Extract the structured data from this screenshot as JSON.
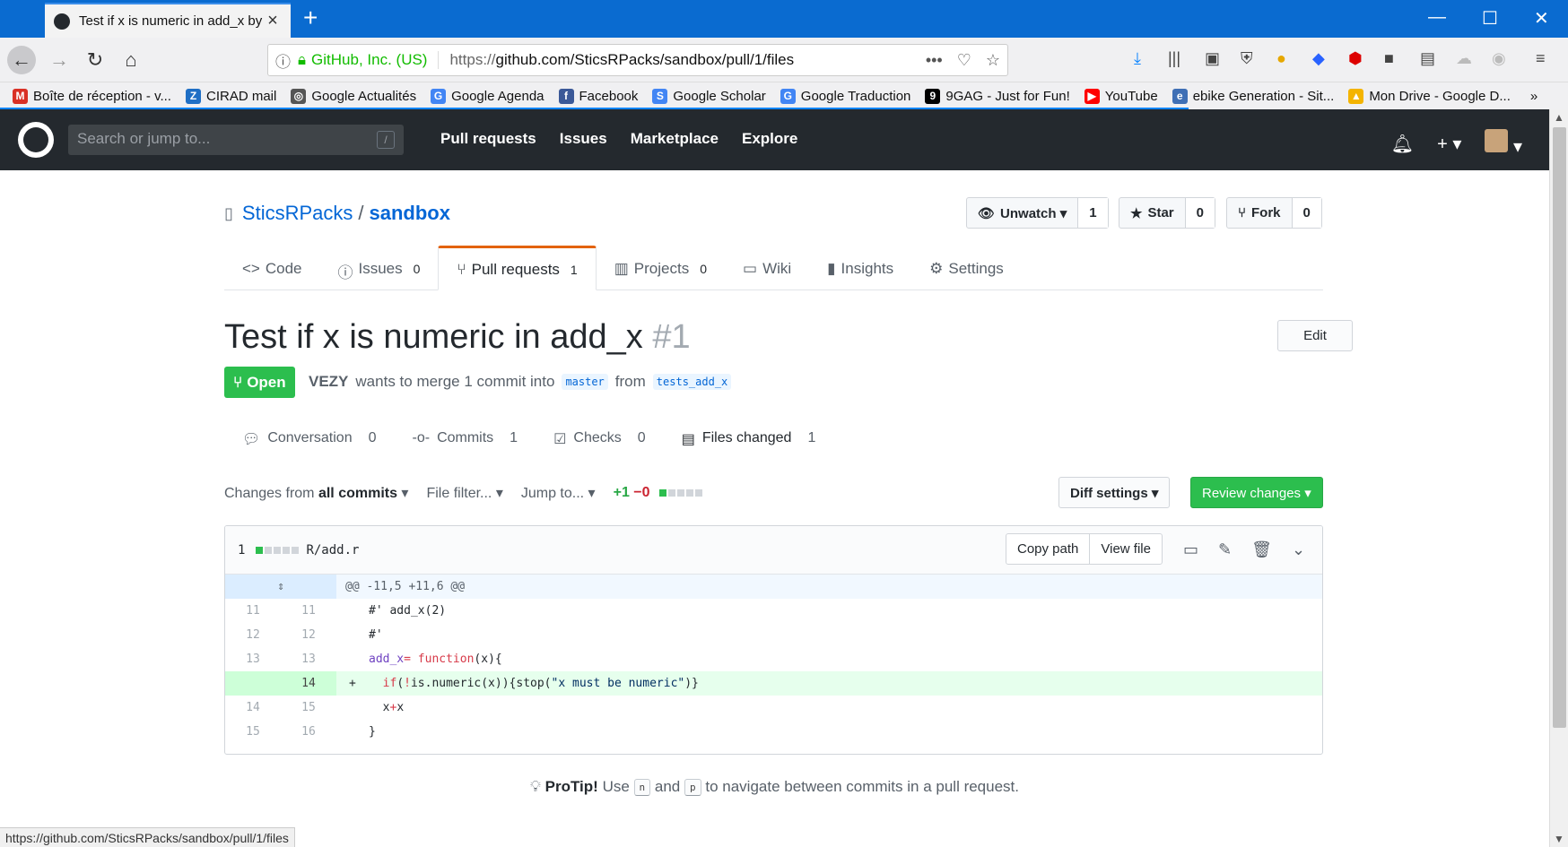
{
  "browser": {
    "tab_title": "Test if x is numeric in add_x by ",
    "url_org": "GitHub, Inc. (US)",
    "url_prefix": "https://",
    "url_host_path": "github.com/SticsRPacks/sandbox/pull/1/files",
    "status_url": "https://github.com/SticsRPacks/sandbox/pull/1/files",
    "bookmarks": [
      {
        "label": "Boîte de réception - v...",
        "icon": "gmail-icon",
        "color": "#d93025",
        "glyph": "M"
      },
      {
        "label": "CIRAD mail",
        "icon": "zimbra-icon",
        "color": "#1f6fc5",
        "glyph": "Z"
      },
      {
        "label": "Google Actualités",
        "icon": "globe-icon",
        "color": "#555555",
        "glyph": "◎"
      },
      {
        "label": "Google Agenda",
        "icon": "google-icon",
        "color": "#4285f4",
        "glyph": "G"
      },
      {
        "label": "Facebook",
        "icon": "facebook-icon",
        "color": "#3b5998",
        "glyph": "f"
      },
      {
        "label": "Google Scholar",
        "icon": "scholar-icon",
        "color": "#4285f4",
        "glyph": "S"
      },
      {
        "label": "Google Traduction",
        "icon": "translate-icon",
        "color": "#4285f4",
        "glyph": "G"
      },
      {
        "label": "9GAG - Just for Fun!",
        "icon": "9gag-icon",
        "color": "#000000",
        "glyph": "9"
      },
      {
        "label": "YouTube",
        "icon": "youtube-icon",
        "color": "#ff0000",
        "glyph": "▶"
      },
      {
        "label": "ebike Generation - Sit...",
        "icon": "ebike-icon",
        "color": "#3f6fb5",
        "glyph": "e"
      },
      {
        "label": "Mon Drive - Google D...",
        "icon": "drive-icon",
        "color": "#f4b400",
        "glyph": "▲"
      }
    ]
  },
  "gh": {
    "search_placeholder": "Search or jump to...",
    "search_key": "/",
    "nav": [
      "Pull requests",
      "Issues",
      "Marketplace",
      "Explore"
    ]
  },
  "repo": {
    "owner": "SticsRPacks",
    "sep": "/",
    "name": "sandbox",
    "watch_label": "Unwatch ▾",
    "watch_count": "1",
    "star_label": "Star",
    "star_count": "0",
    "fork_label": "Fork",
    "fork_count": "0",
    "tabs": [
      {
        "label": "Code",
        "count": ""
      },
      {
        "label": "Issues",
        "count": "0"
      },
      {
        "label": "Pull requests",
        "count": "1"
      },
      {
        "label": "Projects",
        "count": "0"
      },
      {
        "label": "Wiki",
        "count": ""
      },
      {
        "label": "Insights",
        "count": ""
      },
      {
        "label": "Settings",
        "count": ""
      }
    ]
  },
  "pr": {
    "title": "Test if x is numeric in add_x",
    "number": "#1",
    "edit_label": "Edit",
    "state": "Open",
    "author": "VEZY",
    "merge_text": "wants to merge 1 commit into",
    "base": "master",
    "from_text": "from",
    "head": "tests_add_x",
    "tabs": [
      {
        "label": "Conversation",
        "count": "0"
      },
      {
        "label": "Commits",
        "count": "1"
      },
      {
        "label": "Checks",
        "count": "0"
      },
      {
        "label": "Files changed",
        "count": "1"
      }
    ]
  },
  "toolbar": {
    "changes_prefix": "Changes from",
    "changes_value": "all commits",
    "file_filter": "File filter...",
    "jump_to": "Jump to...",
    "additions": "+1",
    "deletions": "−0",
    "diff_settings": "Diff settings ▾",
    "review": "Review changes ▾"
  },
  "file": {
    "changes": "1",
    "path": "R/add.r",
    "copy_path": "Copy path",
    "view_file": "View file",
    "hunk": "@@ -11,5 +11,6 @@",
    "lines": [
      {
        "old": "11",
        "new": "11",
        "sign": " ",
        "text": "#' add_x(2)"
      },
      {
        "old": "12",
        "new": "12",
        "sign": " ",
        "text": "#'"
      },
      {
        "old": "13",
        "new": "13",
        "sign": " ",
        "text": "add_x= function(x){"
      },
      {
        "old": "",
        "new": "14",
        "sign": "+",
        "text": "  if(!is.numeric(x)){stop(\"x must be numeric\")}"
      },
      {
        "old": "14",
        "new": "15",
        "sign": " ",
        "text": "  x+x"
      },
      {
        "old": "15",
        "new": "16",
        "sign": " ",
        "text": "}"
      }
    ]
  },
  "protip": {
    "bold": "ProTip!",
    "use": "Use",
    "key_n": "n",
    "and": "and",
    "key_p": "p",
    "rest": "to navigate between commits in a pull request."
  }
}
